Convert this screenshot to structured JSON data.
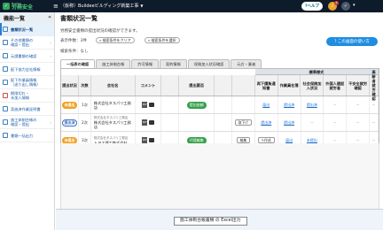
{
  "topbar": {
    "logo_sub": "Buildee",
    "logo_main": "労務安全",
    "menu_icon": "hamburger-icon",
    "project": "（仮称）Buildeeビルディング新築工事",
    "help": "ヘルプ",
    "bell_badge": "3",
    "user_initial": "✓",
    "user_name": "ユーザー"
  },
  "sidebar": {
    "title": "機能一覧",
    "collapse": "«",
    "items": [
      {
        "label": "書類状況一覧",
        "active": true
      },
      {
        "label": "その他書類の\n確認・提出",
        "active": false
      },
      {
        "label": "元請書類の確認",
        "active": false
      },
      {
        "label": "配下協力会社情報",
        "active": false
      },
      {
        "label": "配下作業員情報\n（送り出し情報）",
        "active": false
      },
      {
        "label": "期限切れ・\n未加入情報",
        "active": false
      },
      {
        "label": "実施済作業証明書",
        "active": false
      },
      {
        "label": "施工体制台帳の\n確認・提出",
        "active": false
      },
      {
        "label": "書類一括出力",
        "active": false
      }
    ]
  },
  "main": {
    "title": "書類状況一覧",
    "description": "労務安全書類の提出状況の確認ができます。",
    "count": "表示件数：3件",
    "cond_btn_1": "検索条件をクリア",
    "cond_btn_2": "検索条件を選択",
    "search_condition": "検索条件：なし",
    "howto": "この画面の使い方"
  },
  "tabs": [
    "一括表の確認",
    "施工体制台帳",
    "許可情報",
    "契約情報",
    "保険加入状況確認",
    "元方・業者"
  ],
  "table": {
    "group_header": "標準様式",
    "headers": [
      "提出状況",
      "次数",
      "会社名",
      "コメント",
      "",
      "提出要否",
      "",
      "",
      "再下請負通知書",
      "作業員名簿",
      "社会保険加入状況",
      "外国人建設就労者",
      "不安全就労確認",
      "高齢者就労確認"
    ],
    "rows": [
      {
        "status": "未提出",
        "status_type": "orange",
        "tier": "1次",
        "company": "株式会社タスパリ工務店",
        "company_sub": "",
        "comment_icon": "PDF",
        "action": "提出依頼",
        "action_type": "green",
        "extra": "",
        "c8": "届出",
        "c9": "提出済",
        "c10": "提出済",
        "c11": "－",
        "c12": "－",
        "c13": "－"
      },
      {
        "status": "提出済",
        "status_type": "blue",
        "tier": "2次",
        "company": "株式会社タスパリ工務店",
        "company_sub": "株式会社タスパリ工務店",
        "comment_icon": "PDF",
        "action": "",
        "action_type": "",
        "extra": "取下げ",
        "c8": "提出済",
        "c9": "提出済",
        "c10": "－",
        "c11": "－",
        "c12": "－",
        "c13": "－"
      },
      {
        "status": "未提出",
        "status_type": "orange",
        "tier": "3次",
        "company": "トヨス建工株式会社",
        "company_sub": "株式会社タスパリ工務店",
        "comment_icon": "PDF",
        "action": "代理編集",
        "action_type": "green",
        "extra": "編集",
        "c8": "作成",
        "c9": "届出",
        "c10": "未提出",
        "c11": "－",
        "c12": "－",
        "c13": "－"
      }
    ]
  },
  "bottom": {
    "excel_btn": "施工体制台帳書類 の Excel出力"
  }
}
